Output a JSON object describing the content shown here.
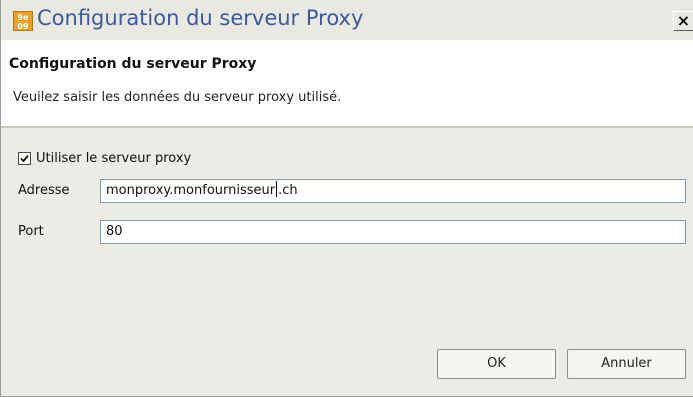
{
  "window": {
    "title": "Configuration du serveur Proxy",
    "icon": "app-icon",
    "icon_text": "9e09",
    "close_label": "×",
    "colors": {
      "title_text": "#3a5a9a",
      "titlebar_bg": "#e9e8e2",
      "content_bg": "#ecebe5",
      "field_border": "#7f9db9"
    }
  },
  "header": {
    "title": "Configuration du serveur Proxy",
    "description": "Veuilez saisir les données du serveur proxy utilisé."
  },
  "form": {
    "use_proxy": {
      "label": "Utiliser le serveur proxy",
      "checked": true
    },
    "address": {
      "label": "Adresse",
      "value_before_caret": "monproxy.monfournisseur",
      "value_after_caret": ".ch"
    },
    "port": {
      "label": "Port",
      "value": "80"
    }
  },
  "buttons": {
    "ok_label": "OK",
    "cancel_label": "Annuler"
  }
}
